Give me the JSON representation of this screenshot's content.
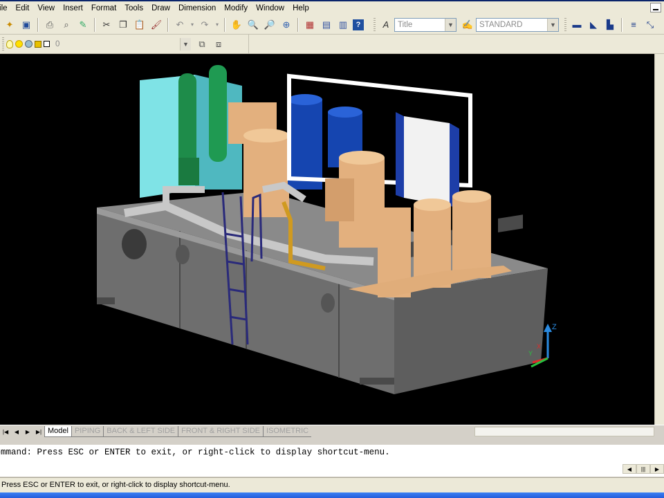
{
  "menu": {
    "items": [
      "File",
      "Edit",
      "View",
      "Insert",
      "Format",
      "Tools",
      "Draw",
      "Dimension",
      "Modify",
      "Window",
      "Help"
    ]
  },
  "toolbar": {
    "text_style": "Title",
    "dim_style": "STANDARD",
    "layer": "0"
  },
  "layout_tabs": {
    "tabs": [
      "Model",
      "PIPING",
      "BACK & LEFT SIDE",
      "FRONT & RIGHT SIDE",
      "ISOMETRIC"
    ],
    "active": "Model"
  },
  "ucs": {
    "x": "X",
    "y": "Y",
    "z": "Z"
  },
  "command": {
    "line": "Command: Press ESC or ENTER to exit, or right-click to display shortcut-menu."
  },
  "status": {
    "text": "Press ESC or ENTER to exit, or right-click to display shortcut-menu."
  },
  "colors": {
    "canvas": "#000000",
    "skid": "#707070",
    "tan_equipment": "#e3b07e",
    "blue_filters": "#1545b0",
    "green_pumps": "#1e8c4a",
    "cyan_panel": "#7fe3e6"
  }
}
